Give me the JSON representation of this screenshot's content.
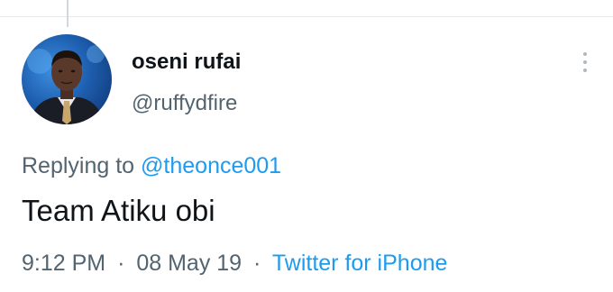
{
  "tweet": {
    "author": {
      "display_name": "oseni rufai",
      "handle": "@ruffydfire",
      "avatar_icon": "user-photo-avatar"
    },
    "more_icon": "vertical-ellipsis-icon",
    "replying_prefix": "Replying to",
    "replying_to": "@theonce001",
    "text": "Team Atiku obi",
    "time": "9:12 PM",
    "date": "08 May 19",
    "separator": "·",
    "source": "Twitter for iPhone"
  },
  "colors": {
    "primary_text": "#0f1419",
    "secondary_text": "#536471",
    "link": "#1d9bf0",
    "divider": "#e7e9ea"
  }
}
